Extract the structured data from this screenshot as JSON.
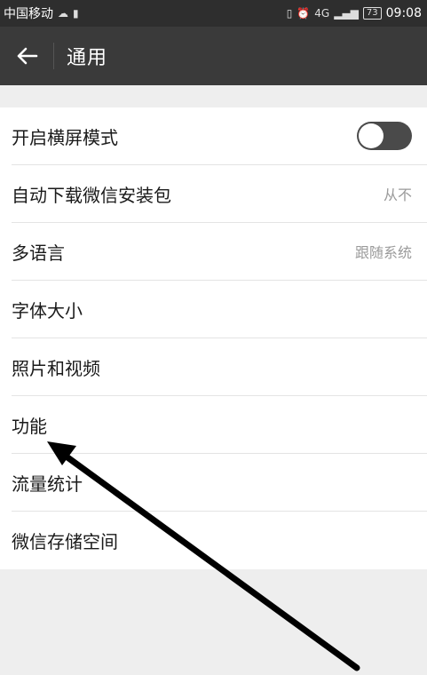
{
  "status_bar": {
    "carrier": "中国移动",
    "time": "09:08",
    "battery": "73",
    "network": "4G",
    "icons": [
      "cloud-icon",
      "sim-icon",
      "vibrate-icon",
      "alarm-icon",
      "signal-icon",
      "battery-icon"
    ]
  },
  "header": {
    "back_icon": "arrow-left-icon",
    "title": "通用"
  },
  "settings": {
    "landscape_label": "开启横屏模式",
    "landscape_toggle_on": false,
    "auto_download_label": "自动下载微信安装包",
    "auto_download_value": "从不",
    "language_label": "多语言",
    "language_value": "跟随系统",
    "font_size_label": "字体大小",
    "photos_videos_label": "照片和视频",
    "features_label": "功能",
    "data_usage_label": "流量统计",
    "storage_label": "微信存储空间"
  },
  "colors": {
    "status_bar_bg": "#2e2e2e",
    "title_bar_bg": "#3a3a3a",
    "page_bg": "#eeeeee",
    "list_bg": "#ffffff",
    "toggle_off": "#4a4a4a",
    "annotation_arrow": "#000000"
  }
}
